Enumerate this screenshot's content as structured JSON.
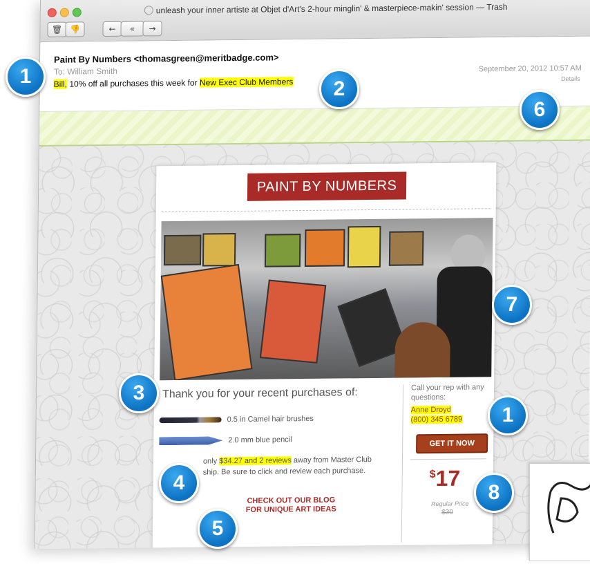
{
  "window": {
    "title": "unleash your inner artiste at Objet d'Art's 2-hour minglin' & masterpiece-makin' session — Trash",
    "toolbar": {
      "delete_icon": "trash-icon",
      "junk_icon": "thumbs-down-icon",
      "reply_icon": "reply-icon",
      "reply_all_icon": "reply-all-icon",
      "forward_icon": "forward-icon",
      "print_icon": "print-icon",
      "flag_icon": "flag-icon"
    }
  },
  "email": {
    "from": "Paint By Numbers <thomasgreen@meritbadge.com>",
    "to_label": "To:",
    "to": "William Smith",
    "subject_name": "Bill,",
    "subject_text": " 10% off all purchases this week for ",
    "subject_highlight": "New Exec Club Members",
    "date": "September 20, 2012  10:57 AM",
    "details": "Details"
  },
  "card": {
    "logo": "PAINT BY NUMBERS",
    "thanks": "Thank you for your recent purchases of:",
    "items": [
      "0.5 in Camel hair brushes",
      "2.0 mm blue pencil"
    ],
    "reviews_prefix": "only ",
    "reviews_highlight": "$34.27 and 2 reviews",
    "reviews_suffix": " away from Master Club",
    "reviews_line2": "ship. Be sure to click and review each purchase.",
    "blog_line1": "CHECK OUT OUR BLOG",
    "blog_line2": "FOR UNIQUE ART IDEAS",
    "rep_label": "Call your rep with any questions:",
    "rep_name": "Anne Droyd",
    "rep_phone": "(800) 345 6789",
    "cta": "GET IT NOW",
    "price_symbol": "$",
    "price": "17",
    "regular_label": "Regular Price",
    "regular_price": "$30"
  },
  "badges": [
    "1",
    "2",
    "3",
    "4",
    "5",
    "6",
    "7",
    "1",
    "8"
  ],
  "colors": {
    "accent_red": "#a82b27",
    "highlight": "#ffff00",
    "badge_blue": "#0d72c3",
    "banner_green": "#eaf5c8"
  }
}
